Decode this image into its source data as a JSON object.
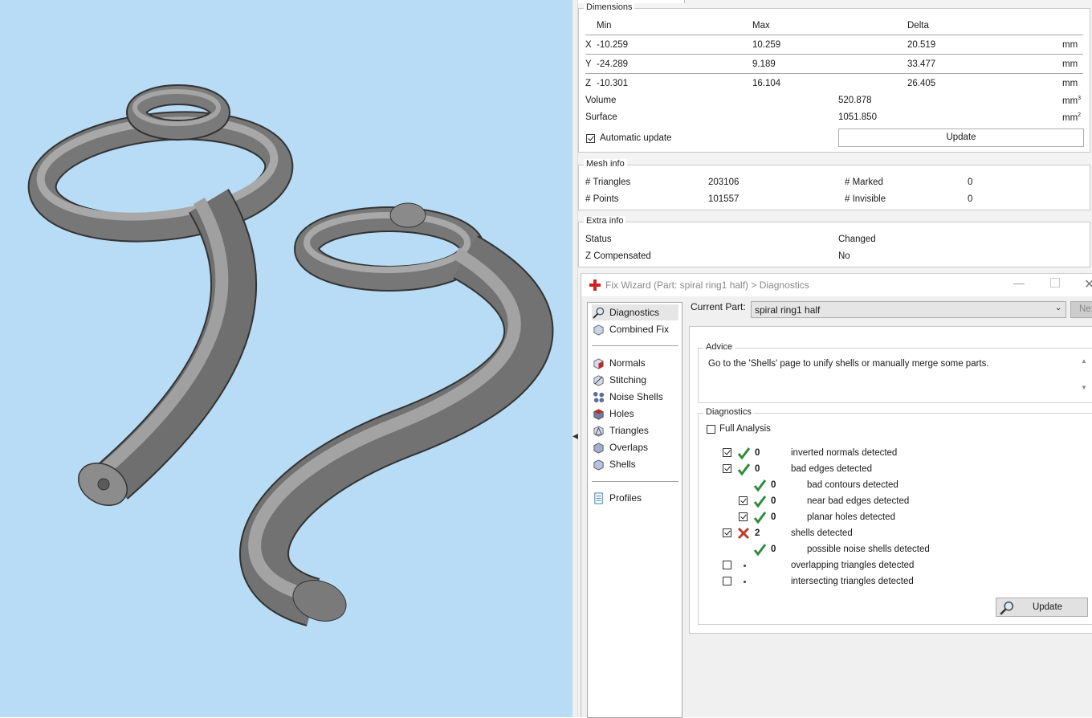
{
  "dimensions": {
    "title": "Dimensions",
    "headers": {
      "min": "Min",
      "max": "Max",
      "delta": "Delta"
    },
    "rows": [
      {
        "axis": "X",
        "min": "-10.259",
        "max": "10.259",
        "delta": "20.519",
        "unit": "mm"
      },
      {
        "axis": "Y",
        "min": "-24.289",
        "max": "9.189",
        "delta": "33.477",
        "unit": "mm"
      },
      {
        "axis": "Z",
        "min": "-10.301",
        "max": "16.104",
        "delta": "26.405",
        "unit": "mm"
      }
    ],
    "volume": {
      "label": "Volume",
      "value": "520.878",
      "unit": "mm",
      "exp": "3"
    },
    "surface": {
      "label": "Surface",
      "value": "1051.850",
      "unit": "mm",
      "exp": "2"
    },
    "auto_update": {
      "label": "Automatic update",
      "checked": true
    },
    "update_button": "Update"
  },
  "mesh_info": {
    "title": "Mesh info",
    "triangles_label": "# Triangles",
    "triangles": "203106",
    "points_label": "# Points",
    "points": "101557",
    "marked_label": "# Marked",
    "marked": "0",
    "invisible_label": "# Invisible",
    "invisible": "0"
  },
  "extra_info": {
    "title": "Extra info",
    "status_label": "Status",
    "status": "Changed",
    "zcomp_label": "Z Compensated",
    "zcomp": "No"
  },
  "wizard": {
    "title": "Fix Wizard (Part: spiral ring1 half) > Diagnostics",
    "sidebar": [
      {
        "label": "Diagnostics",
        "icon": "magnifier-icon"
      },
      {
        "label": "Combined Fix",
        "icon": "combined-fix-icon"
      },
      {
        "label": "Normals",
        "icon": "normals-icon"
      },
      {
        "label": "Stitching",
        "icon": "stitching-icon"
      },
      {
        "label": "Noise Shells",
        "icon": "noise-shells-icon"
      },
      {
        "label": "Holes",
        "icon": "holes-icon"
      },
      {
        "label": "Triangles",
        "icon": "triangles-icon"
      },
      {
        "label": "Overlaps",
        "icon": "overlaps-icon"
      },
      {
        "label": "Shells",
        "icon": "shells-icon"
      },
      {
        "label": "Profiles",
        "icon": "profiles-icon"
      }
    ],
    "current_part_label": "Current Part:",
    "current_part_value": "spiral ring1 half",
    "next_button": "Nex",
    "advice_title": "Advice",
    "advice_text": "Go to the 'Shells' page to unify shells or manually merge some parts.",
    "diagnostics_title": "Diagnostics",
    "full_analysis": "Full Analysis",
    "update_button": "Update",
    "items": [
      {
        "count": "0",
        "label": "inverted normals detected",
        "status": "ok"
      },
      {
        "count": "0",
        "label": "bad edges detected",
        "status": "ok"
      },
      {
        "count": "0",
        "label": "bad contours detected",
        "status": "ok"
      },
      {
        "count": "0",
        "label": "near bad edges detected",
        "status": "ok"
      },
      {
        "count": "0",
        "label": "planar holes detected",
        "status": "ok"
      },
      {
        "count": "2",
        "label": "shells detected",
        "status": "error"
      },
      {
        "count": "0",
        "label": "possible noise shells detected",
        "status": "ok"
      },
      {
        "count": "",
        "label": "overlapping triangles detected",
        "status": "not-run"
      },
      {
        "count": "",
        "label": "intersecting triangles detected",
        "status": "not-run"
      }
    ]
  },
  "colors": {
    "viewport_bg": "#b8dcf5",
    "ok_check": "#2e8b3e",
    "error_cross": "#c0392b"
  }
}
